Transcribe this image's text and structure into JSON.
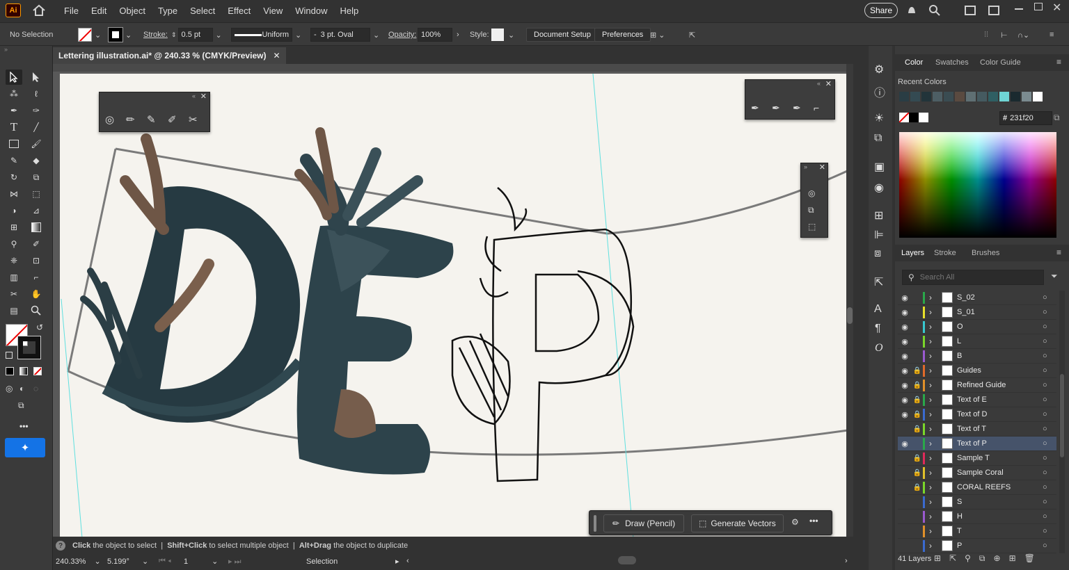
{
  "menubar": {
    "logo": "Ai",
    "items": [
      "File",
      "Edit",
      "Object",
      "Type",
      "Select",
      "Effect",
      "View",
      "Window",
      "Help"
    ],
    "share_label": "Share"
  },
  "control_bar": {
    "selection_label": "No Selection",
    "stroke_label": "Stroke:",
    "stroke_value": "0.5 pt",
    "profile_label": "Uniform",
    "brush_label": "3 pt. Oval",
    "opacity_label": "Opacity:",
    "opacity_value": "100%",
    "style_label": "Style:",
    "document_setup_label": "Document Setup",
    "preferences_label": "Preferences"
  },
  "document": {
    "tab_title": "Lettering illustration.ai* @ 240.33 % (CMYK/Preview)"
  },
  "contextual_bar": {
    "draw_label": "Draw (Pencil)",
    "generate_label": "Generate Vectors"
  },
  "statusbar": {
    "hint_click": "Click",
    "hint_click_text": "the object to select",
    "hint_shift": "Shift+Click",
    "hint_shift_text": "to select multiple object",
    "hint_alt": "Alt+Drag",
    "hint_alt_text": "the object to duplicate",
    "zoom_value": "240.33%",
    "rotation_value": "5.199°",
    "artboard_value": "1",
    "tool_name": "Selection"
  },
  "color_panel": {
    "tabs": [
      "Color",
      "Swatches",
      "Color Guide"
    ],
    "recent_colors_label": "Recent Colors",
    "recent_colors": [
      "#2a3d44",
      "#344a52",
      "#22343a",
      "#4d5e64",
      "#3a4c52",
      "#5a4a40",
      "#5f6f73",
      "#455a60",
      "#2f5f63",
      "#6fd4d4",
      "#1a2a2f",
      "#7b8b90",
      "#ffffff"
    ],
    "hex_value": "231f20"
  },
  "layers_panel": {
    "tabs": [
      "Layers",
      "Stroke",
      "Brushes"
    ],
    "search_placeholder": "Search All",
    "count_label": "41 Layers",
    "layers": [
      {
        "name": "S_02",
        "visible": true,
        "locked": false,
        "color": "#2aa84a",
        "selected": false
      },
      {
        "name": "S_01",
        "visible": true,
        "locked": false,
        "color": "#e8e02a",
        "selected": false
      },
      {
        "name": "O",
        "visible": true,
        "locked": false,
        "color": "#38c8d0",
        "selected": false
      },
      {
        "name": "L",
        "visible": true,
        "locked": false,
        "color": "#7ad62a",
        "selected": false
      },
      {
        "name": "B",
        "visible": true,
        "locked": false,
        "color": "#9a5ad0",
        "selected": false
      },
      {
        "name": "Guides",
        "visible": true,
        "locked": true,
        "color": "#e06a2a",
        "selected": false
      },
      {
        "name": "Refined Guide",
        "visible": true,
        "locked": true,
        "color": "#e0902a",
        "selected": false
      },
      {
        "name": "Text of E",
        "visible": true,
        "locked": true,
        "color": "#2aa84a",
        "selected": false
      },
      {
        "name": "Text of D",
        "visible": true,
        "locked": true,
        "color": "#3a6ad0",
        "selected": false
      },
      {
        "name": "Text of T",
        "visible": false,
        "locked": true,
        "color": "#7ad62a",
        "selected": false
      },
      {
        "name": "Text of P",
        "visible": true,
        "locked": false,
        "color": "#2aa84a",
        "selected": true
      },
      {
        "name": "Sample T",
        "visible": false,
        "locked": true,
        "color": "#e02a5a",
        "selected": false
      },
      {
        "name": "Sample Coral",
        "visible": false,
        "locked": true,
        "color": "#e0c02a",
        "selected": false
      },
      {
        "name": "CORAL REEFS",
        "visible": false,
        "locked": true,
        "color": "#7ad62a",
        "selected": false
      },
      {
        "name": "S",
        "visible": false,
        "locked": false,
        "color": "#3a6ad0",
        "selected": false
      },
      {
        "name": "H",
        "visible": false,
        "locked": false,
        "color": "#9a5ad0",
        "selected": false
      },
      {
        "name": "T",
        "visible": false,
        "locked": false,
        "color": "#e0902a",
        "selected": false
      },
      {
        "name": "P",
        "visible": false,
        "locked": false,
        "color": "#3a6ad0",
        "selected": false
      }
    ]
  }
}
